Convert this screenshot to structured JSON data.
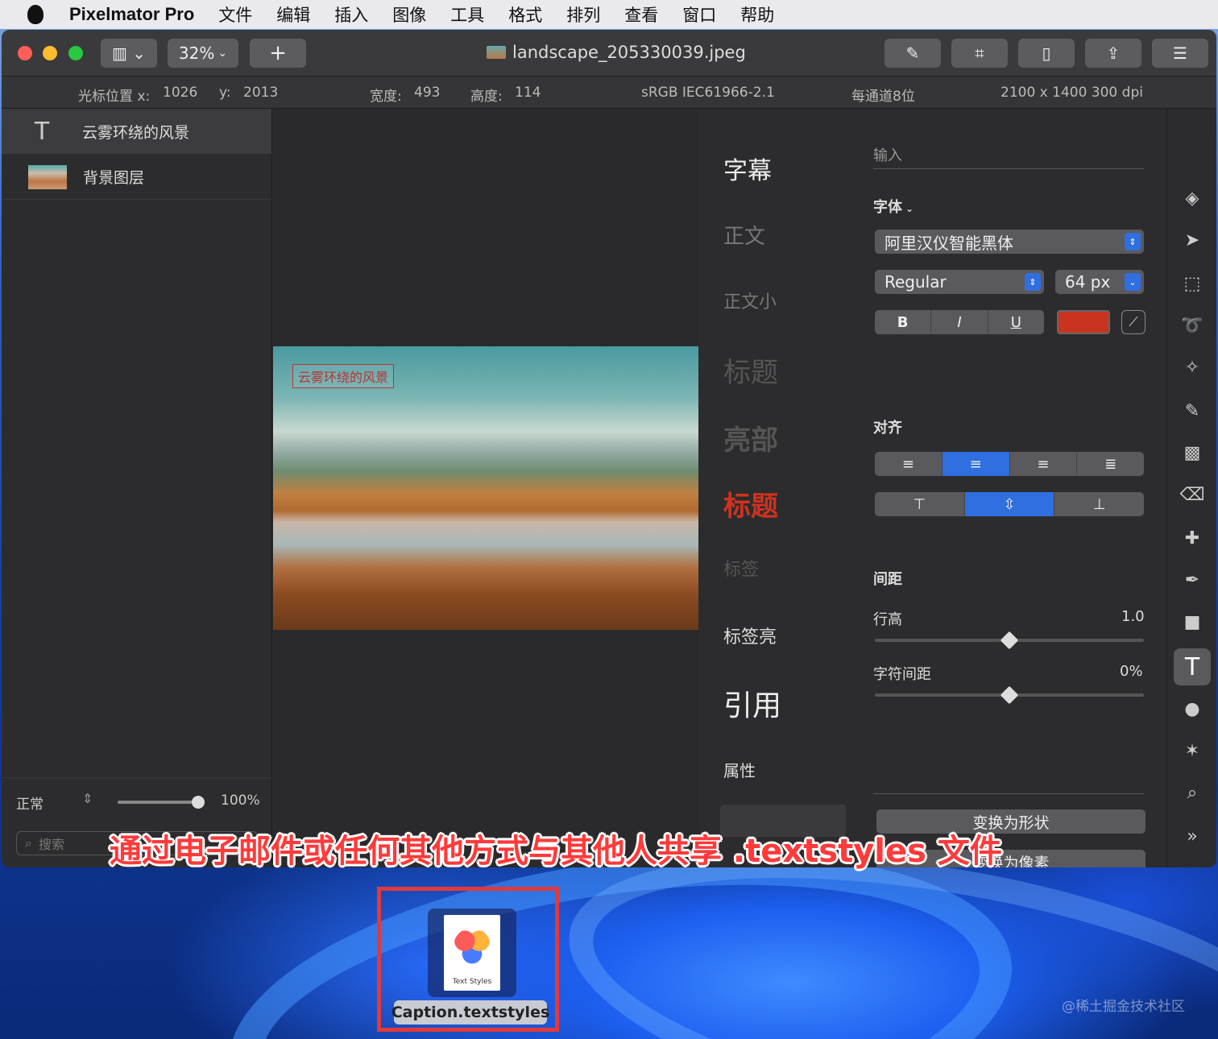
{
  "menubar": {
    "app": "Pixelmator Pro",
    "items": [
      "文件",
      "编辑",
      "插入",
      "图像",
      "工具",
      "格式",
      "排列",
      "查看",
      "窗口",
      "帮助"
    ]
  },
  "toolbar": {
    "zoom": "32%",
    "add": "+",
    "title": "landscape_205330039.jpeg"
  },
  "info": {
    "cursor_x_label": "光标位置 x:",
    "cursor_x": "1026",
    "cursor_y_label": "y:",
    "cursor_y": "2013",
    "width_label": "宽度:",
    "width": "493",
    "height_label": "高度:",
    "height": "114",
    "color_profile": "sRGB IEC61966-2.1",
    "bit_depth": "每通道8位",
    "dimensions": "2100 x 1400 300 dpi"
  },
  "layers": [
    {
      "name": "云雾环绕的风景",
      "icon": "T"
    },
    {
      "name": "背景图层"
    }
  ],
  "layers_footer": {
    "blend_mode": "正常",
    "opacity": "100%",
    "opacity_value": 1.0,
    "search_placeholder": "搜索"
  },
  "canvas": {
    "caption_text": "云雾环绕的风景"
  },
  "text_styles": [
    "字幕",
    "正文",
    "正文小",
    "标题",
    "亮部",
    "标题",
    "标签",
    "标签亮",
    "引用"
  ],
  "styles_footer": "属性",
  "props": {
    "input_placeholder": "输入",
    "font_label": "字体",
    "font_family": "阿里汉仪智能黑体",
    "font_style": "Regular",
    "font_size": "64 px",
    "bold": "B",
    "italic": "I",
    "underline": "U",
    "color": "#c8341f",
    "align_label": "对齐",
    "spacing_label": "间距",
    "line_height_label": "行高",
    "line_height": "1.0",
    "line_height_value": 0.5,
    "char_spacing_label": "字符间距",
    "char_spacing": "0%",
    "char_spacing_value": 0.5,
    "convert_shape": "变换为形状",
    "convert_pixels": "变换为像素"
  },
  "tools": [
    "paint-bucket-icon",
    "arrow-icon",
    "selection-icon",
    "lasso-icon",
    "magic-wand-icon",
    "brush-icon",
    "gradient-icon",
    "eraser-icon",
    "bandage-icon",
    "pen-icon",
    "shape-icon",
    "text-icon",
    "color-adjust-icon",
    "effects-icon",
    "zoom-icon",
    "more-icon"
  ],
  "banner": "通过电子邮件或任何其他方式与其他人共享 .textstyles 文件",
  "file": {
    "preview_label": "Text Styles",
    "name": "Caption.textstyles"
  },
  "watermark": "@稀土掘金技术社区"
}
